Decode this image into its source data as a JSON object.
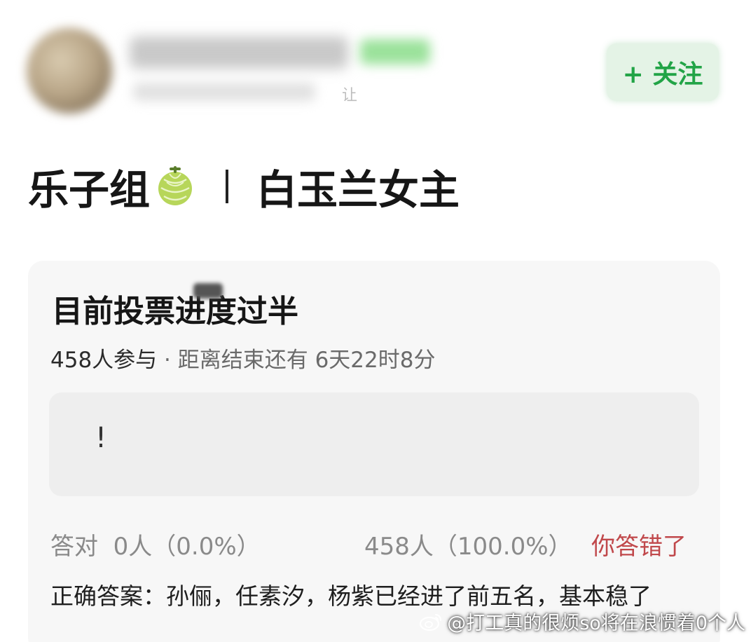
{
  "header": {
    "meta_residue": "让",
    "follow_label": "+ 关注"
  },
  "post": {
    "title_left": "乐子组",
    "title_icon": "melon-emoji-icon",
    "title_separator": "|",
    "title_right": "白玉兰女主"
  },
  "vote": {
    "title": "目前投票进度过半",
    "participants": "458人参与",
    "separator": " · ",
    "time_left": "距离结束还有 6天22时8分",
    "option_text": "!",
    "correct_label": "答对",
    "correct_stat": "0人（0.0%）",
    "other_stat": "458人（100.0%）",
    "wrong_label": "你答错了",
    "answer": "正确答案：孙俪，任素汐，杨紫已经进了前五名，基本稳了"
  },
  "watermark": {
    "text": "@打工真的很烦so将在浪惯着0个人"
  },
  "colors": {
    "follow_green": "#22a447",
    "wrong_red": "#c0484b",
    "card_bg": "#f7f7f7"
  }
}
